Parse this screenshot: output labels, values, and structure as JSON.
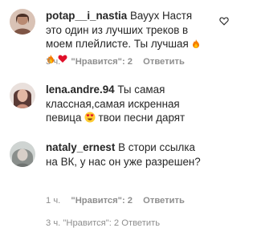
{
  "comments": [
    {
      "username": "potap__i_nastia",
      "text": "Вауух Настя это один из лучших треков в моем плейлисте. Ты лучшая",
      "emojis": [
        "fire-emoji",
        "fire-emoji",
        "red-heart-emoji"
      ],
      "time": "3 ч.",
      "likes": "\"Нравится\": 2",
      "reply": "Ответить"
    },
    {
      "username": "lena.andre.94",
      "text_before_emoji": "Ты самая классная,самая искренная певица",
      "emoji": "heart-eyes-emoji",
      "text_after_emoji": "твои песни дарят",
      "time": "3 ч.",
      "likes": "\"Нравится\": 2",
      "reply": "Ответить"
    },
    {
      "username": "nataly_ernest",
      "text": "В стори ссылка на ВК, у нас он уже разрешен?",
      "time": "1 ч.",
      "likes": "\"Нравится\": 2",
      "reply": "Ответить"
    }
  ],
  "colors": {
    "text": "#262626",
    "muted": "#8e8e8e"
  }
}
